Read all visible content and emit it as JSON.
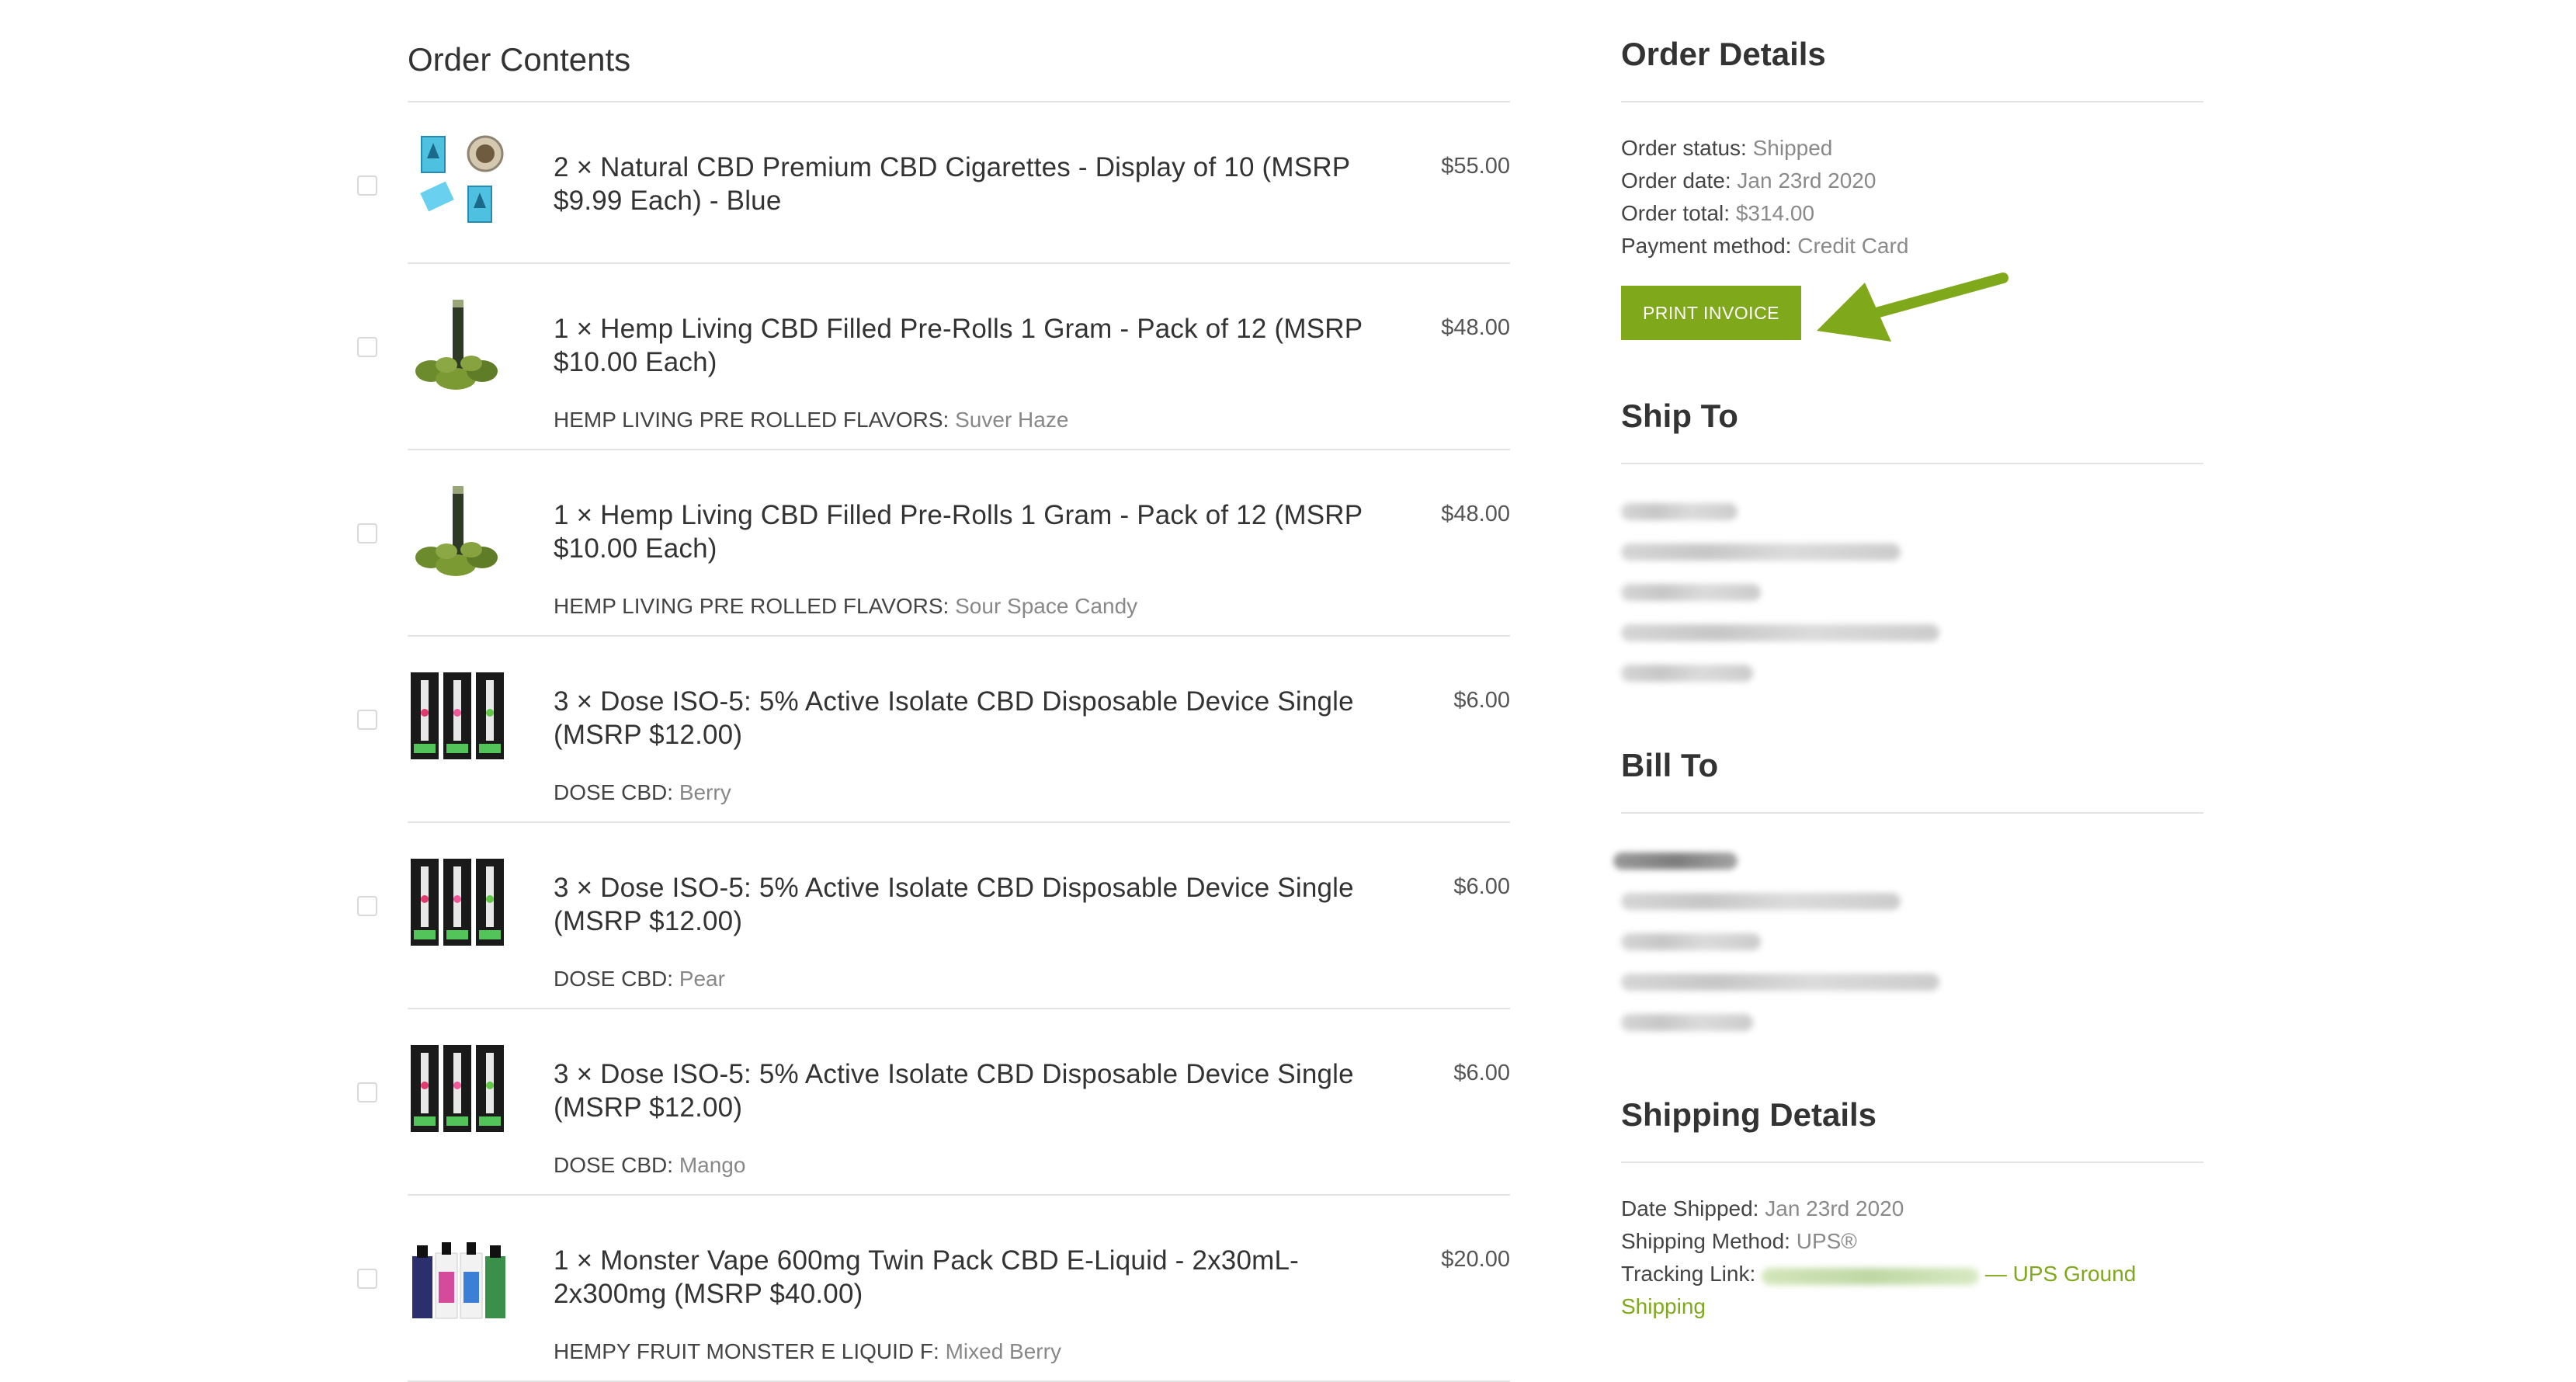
{
  "order_contents": {
    "title": "Order Contents",
    "items": [
      {
        "title": "2 × Natural CBD Premium CBD Cigarettes - Display of 10 (MSRP $9.99 Each) - Blue",
        "price": "$55.00",
        "meta_label": "",
        "meta_value": "",
        "thumb_icon": "cbd-cigarettes-thumbnail"
      },
      {
        "title": "1 × Hemp Living CBD Filled Pre-Rolls 1 Gram - Pack of 12 (MSRP $10.00 Each)",
        "price": "$48.00",
        "meta_label": "HEMP LIVING PRE ROLLED FLAVORS:",
        "meta_value": "Suver Haze",
        "thumb_icon": "pre-roll-thumbnail"
      },
      {
        "title": "1 × Hemp Living CBD Filled Pre-Rolls 1 Gram - Pack of 12 (MSRP $10.00 Each)",
        "price": "$48.00",
        "meta_label": "HEMP LIVING PRE ROLLED FLAVORS:",
        "meta_value": "Sour Space Candy",
        "thumb_icon": "pre-roll-thumbnail"
      },
      {
        "title": "3 × Dose ISO-5: 5% Active Isolate CBD Disposable Device Single (MSRP $12.00)",
        "price": "$6.00",
        "meta_label": "DOSE CBD:",
        "meta_value": "Berry",
        "thumb_icon": "dose-device-thumbnail"
      },
      {
        "title": "3 × Dose ISO-5: 5% Active Isolate CBD Disposable Device Single (MSRP $12.00)",
        "price": "$6.00",
        "meta_label": "DOSE CBD:",
        "meta_value": "Pear",
        "thumb_icon": "dose-device-thumbnail"
      },
      {
        "title": "3 × Dose ISO-5: 5% Active Isolate CBD Disposable Device Single (MSRP $12.00)",
        "price": "$6.00",
        "meta_label": "DOSE CBD:",
        "meta_value": "Mango",
        "thumb_icon": "dose-device-thumbnail"
      },
      {
        "title": "1 × Monster Vape 600mg Twin Pack CBD E-Liquid - 2x30mL- 2x300mg (MSRP $40.00)",
        "price": "$20.00",
        "meta_label": "HEMPY FRUIT MONSTER E LIQUID F:",
        "meta_value": "Mixed Berry",
        "thumb_icon": "e-liquid-thumbnail"
      }
    ]
  },
  "order_details": {
    "title": "Order Details",
    "status_label": "Order status:",
    "status_value": "Shipped",
    "date_label": "Order date:",
    "date_value": "Jan 23rd 2020",
    "total_label": "Order total:",
    "total_value": "$314.00",
    "payment_label": "Payment method:",
    "payment_value": "Credit Card",
    "print_button": "PRINT INVOICE",
    "accent_color": "#7fa81a",
    "arrow_icon": "arrow-left-icon"
  },
  "ship_to": {
    "title": "Ship To"
  },
  "bill_to": {
    "title": "Bill To"
  },
  "shipping_details": {
    "title": "Shipping Details",
    "date_label": "Date Shipped:",
    "date_value": "Jan 23rd 2020",
    "method_label": "Shipping Method:",
    "method_value": "UPS®",
    "tracking_label": "Tracking Link:",
    "tracking_suffix": "— UPS Ground",
    "tracking_suffix2": "Shipping"
  }
}
